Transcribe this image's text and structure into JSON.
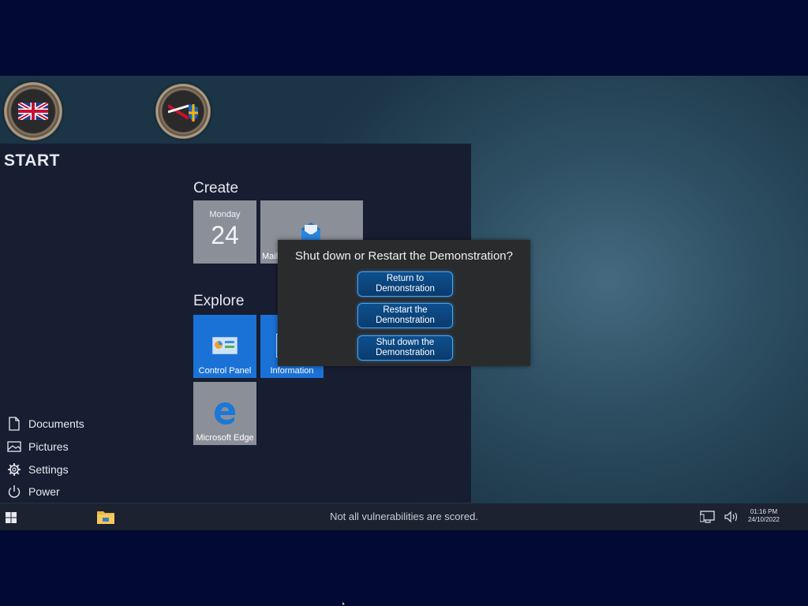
{
  "desktop": {
    "icons": [
      {
        "name": "desktop-emblem-uk"
      },
      {
        "name": "desktop-emblem-shield"
      }
    ]
  },
  "start_menu": {
    "title": "START",
    "sections": {
      "create": "Create",
      "explore": "Explore"
    },
    "calendar": {
      "day_name": "Monday",
      "day_number": "24"
    },
    "tiles": {
      "mail": "Mail",
      "control_panel": "Control Panel",
      "information": "Information",
      "edge": "Microsoft Edge"
    },
    "side_items": [
      {
        "label": "Documents",
        "icon": "document-icon"
      },
      {
        "label": "Pictures",
        "icon": "picture-icon"
      },
      {
        "label": "Settings",
        "icon": "gear-icon"
      },
      {
        "label": "Power",
        "icon": "power-icon"
      }
    ]
  },
  "dialog": {
    "title": "Shut down or Restart the Demonstration?",
    "buttons": [
      "Return to Demonstration",
      "Restart the Demonstration",
      "Shut down the Demonstration"
    ]
  },
  "taskbar": {
    "notice": "Not all vulnerabilities are scored.",
    "time": "01:16 PM",
    "date": "24/10/2022"
  },
  "colors": {
    "accent": "#1a72d6",
    "dialog_button_border": "#3fa7ff",
    "menu_bg": "#171e31"
  }
}
